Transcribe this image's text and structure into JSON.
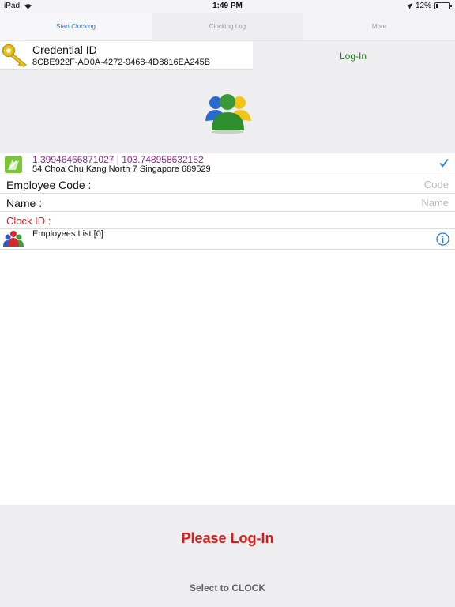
{
  "status_bar": {
    "device": "iPad",
    "time": "1:49 PM",
    "battery_percent": "12%",
    "battery_level": 0.12,
    "icons": [
      "wifi-icon",
      "location-arrow-icon",
      "battery-icon"
    ]
  },
  "tabs": [
    {
      "label": "Start Clocking",
      "active": true
    },
    {
      "label": "Clocking Log",
      "active": false
    },
    {
      "label": "More",
      "active": false
    }
  ],
  "credential": {
    "title": "Credential ID",
    "id": "8CBE922F-AD0A-4272-9468-4D8816EA245B",
    "icon": "key-icon"
  },
  "login_link": "Log-In",
  "group_icon": "users-group-icon",
  "location": {
    "coordinates": "1.39946466871027 | 103.748958632152",
    "address": "54 Choa Chu Kang North 7 Singapore 689529",
    "icon": "map-location-icon",
    "checked": true
  },
  "fields": {
    "employee_code_label": "Employee Code :",
    "employee_code_placeholder": "Code",
    "name_label": "Name :",
    "name_placeholder": "Name",
    "clock_id_label": "Clock ID :"
  },
  "employees": {
    "label": "Employees List [0]",
    "icon": "employees-icon",
    "info_icon": "info-icon"
  },
  "bottom": {
    "please_login": "Please Log-In",
    "select_clock": "Select to CLOCK"
  },
  "colors": {
    "accent_blue": "#1a7ae0",
    "login_green": "#2a7a2a",
    "coords_purple": "#8a2a8a",
    "alert_red": "#e01818"
  }
}
